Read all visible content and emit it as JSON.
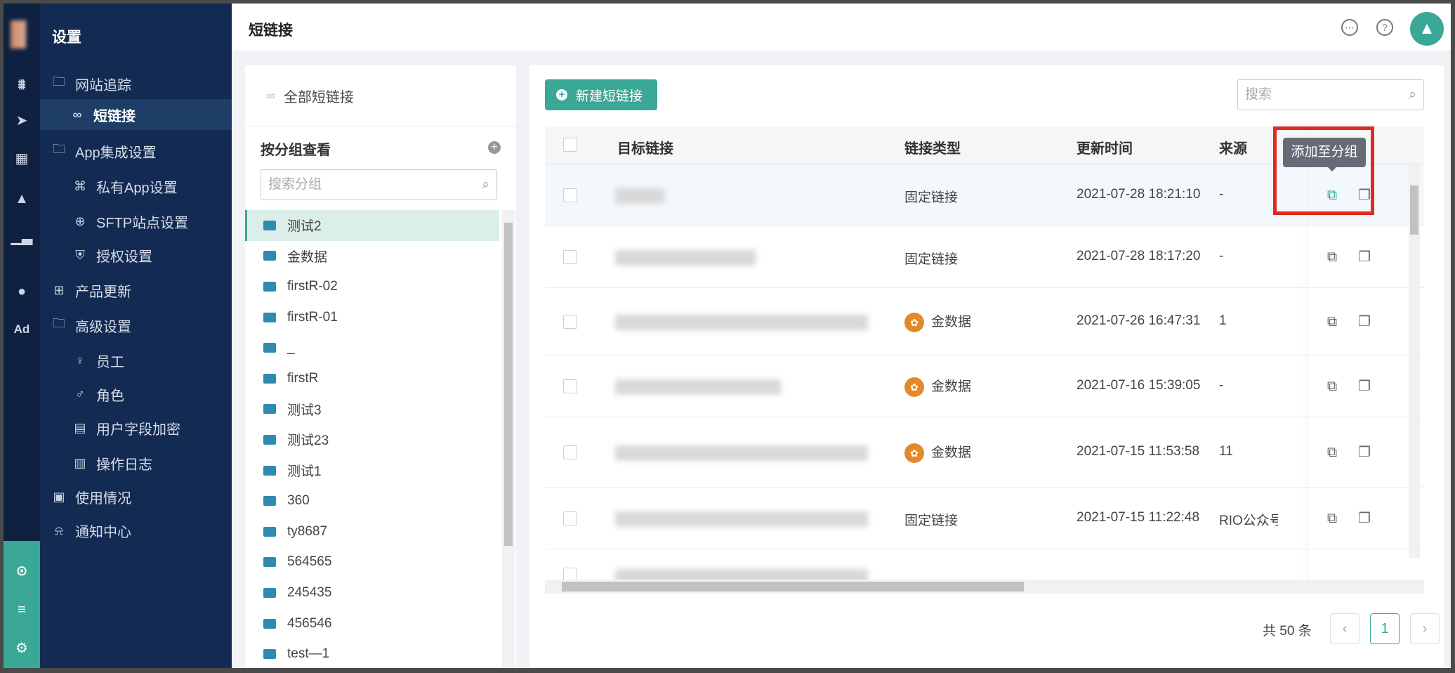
{
  "app": {
    "section_title": "设置",
    "page_title": "短链接"
  },
  "rail": {
    "icons": [
      "shop-icon",
      "send-icon",
      "layout-icon",
      "user-icon",
      "bar-chart-icon",
      "wechat-icon",
      "ad-icon"
    ],
    "ad_label": "Ad"
  },
  "sidebar": {
    "items": [
      {
        "label": "网站追踪",
        "icon": "folder-icon"
      },
      {
        "label": "短链接",
        "icon": "link-icon",
        "active": true
      },
      {
        "label": "App集成设置",
        "icon": "folder-icon"
      },
      {
        "label": "私有App设置",
        "icon": "command-icon"
      },
      {
        "label": "SFTP站点设置",
        "icon": "globe-icon"
      },
      {
        "label": "授权设置",
        "icon": "shield-icon"
      },
      {
        "label": "产品更新",
        "icon": "grid-icon"
      },
      {
        "label": "高级设置",
        "icon": "folder-icon"
      },
      {
        "label": "员工",
        "icon": "user-icon"
      },
      {
        "label": "角色",
        "icon": "users-icon"
      },
      {
        "label": "用户字段加密",
        "icon": "lock-doc-icon"
      },
      {
        "label": "操作日志",
        "icon": "log-icon"
      },
      {
        "label": "使用情况",
        "icon": "usage-icon"
      },
      {
        "label": "通知中心",
        "icon": "bell-icon"
      }
    ]
  },
  "groups": {
    "all_label": "全部短链接",
    "header": "按分组查看",
    "search_placeholder": "搜索分组",
    "items": [
      "测试2",
      "金数据",
      "firstR-02",
      "firstR-01",
      "_",
      "firstR",
      "测试3",
      "测试23",
      "测试1",
      "360",
      "ty8687",
      "564565",
      "245435",
      "456546",
      "test—1"
    ]
  },
  "main": {
    "new_button": "新建短链接",
    "search_placeholder": "搜索",
    "columns": {
      "target": "目标链接",
      "type": "链接类型",
      "updated": "更新时间",
      "source": "来源"
    },
    "rows": [
      {
        "type": "固定链接",
        "type_icon": false,
        "updated": "2021-07-28 18:21:10",
        "source": "-"
      },
      {
        "type": "固定链接",
        "type_icon": false,
        "updated": "2021-07-28 18:17:20",
        "source": "-"
      },
      {
        "type": "金数据",
        "type_icon": true,
        "updated": "2021-07-26 16:47:31",
        "source": "1"
      },
      {
        "type": "金数据",
        "type_icon": true,
        "updated": "2021-07-16 15:39:05",
        "source": "-"
      },
      {
        "type": "金数据",
        "type_icon": true,
        "updated": "2021-07-15 11:53:58",
        "source": "11"
      },
      {
        "type": "固定链接",
        "type_icon": false,
        "updated": "2021-07-15 11:22:48",
        "source": "RIO公众号"
      }
    ],
    "tooltip": "添加至分组",
    "pagination": {
      "total": "共 50 条",
      "current": "1"
    }
  },
  "colors": {
    "accent": "#3aa797",
    "sidebar": "#132b52",
    "highlight": "#e02a1f"
  }
}
